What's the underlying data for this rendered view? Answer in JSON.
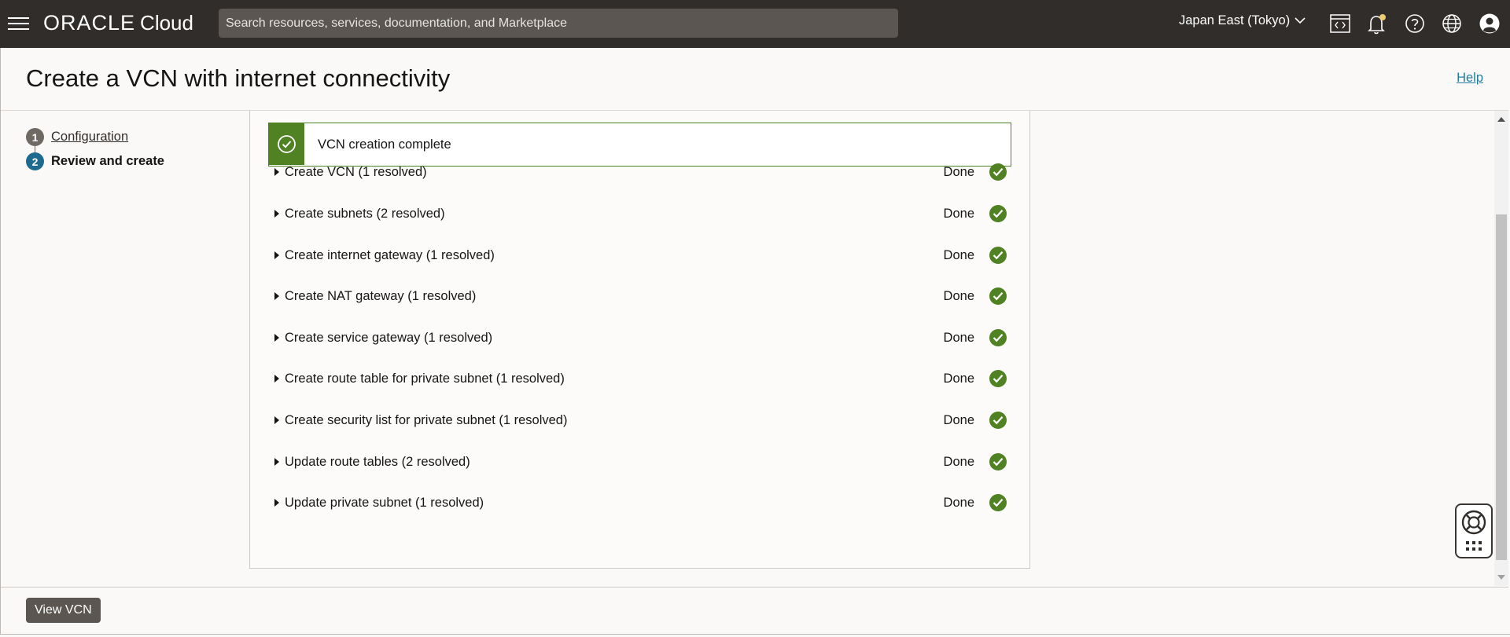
{
  "topbar": {
    "brand_oracle": "ORACLE",
    "brand_cloud": "Cloud",
    "search_placeholder": "Search resources, services, documentation, and Marketplace",
    "region": "Japan East (Tokyo)",
    "icons": [
      "menu-icon",
      "code-editor-icon",
      "notification-bell-icon",
      "help-circle-icon",
      "language-globe-icon",
      "user-profile-icon"
    ]
  },
  "page": {
    "title": "Create a VCN with internet connectivity",
    "help_link": "Help"
  },
  "steps": [
    {
      "number": "1",
      "label": "Configuration",
      "state": "completed"
    },
    {
      "number": "2",
      "label": "Review and create",
      "state": "current"
    }
  ],
  "banner": {
    "text": "VCN creation complete",
    "status": "success",
    "icon": "check-circle-icon"
  },
  "tasks": [
    {
      "label": "Create VCN (1 resolved)",
      "status": "Done"
    },
    {
      "label": "Create subnets (2 resolved)",
      "status": "Done"
    },
    {
      "label": "Create internet gateway (1 resolved)",
      "status": "Done"
    },
    {
      "label": "Create NAT gateway (1 resolved)",
      "status": "Done"
    },
    {
      "label": "Create service gateway (1 resolved)",
      "status": "Done"
    },
    {
      "label": "Create route table for private subnet (1 resolved)",
      "status": "Done"
    },
    {
      "label": "Create security list for private subnet (1 resolved)",
      "status": "Done"
    },
    {
      "label": "Update route tables (2 resolved)",
      "status": "Done"
    },
    {
      "label": "Update private subnet (1 resolved)",
      "status": "Done"
    }
  ],
  "footer": {
    "primary_button": "View VCN"
  },
  "colors": {
    "topbar_bg": "#312d2a",
    "search_bg": "#5b5652",
    "success_green": "#508223",
    "link_blue": "#227e9e",
    "step_current": "#1e6a8f",
    "button_bg": "#5b5652"
  }
}
